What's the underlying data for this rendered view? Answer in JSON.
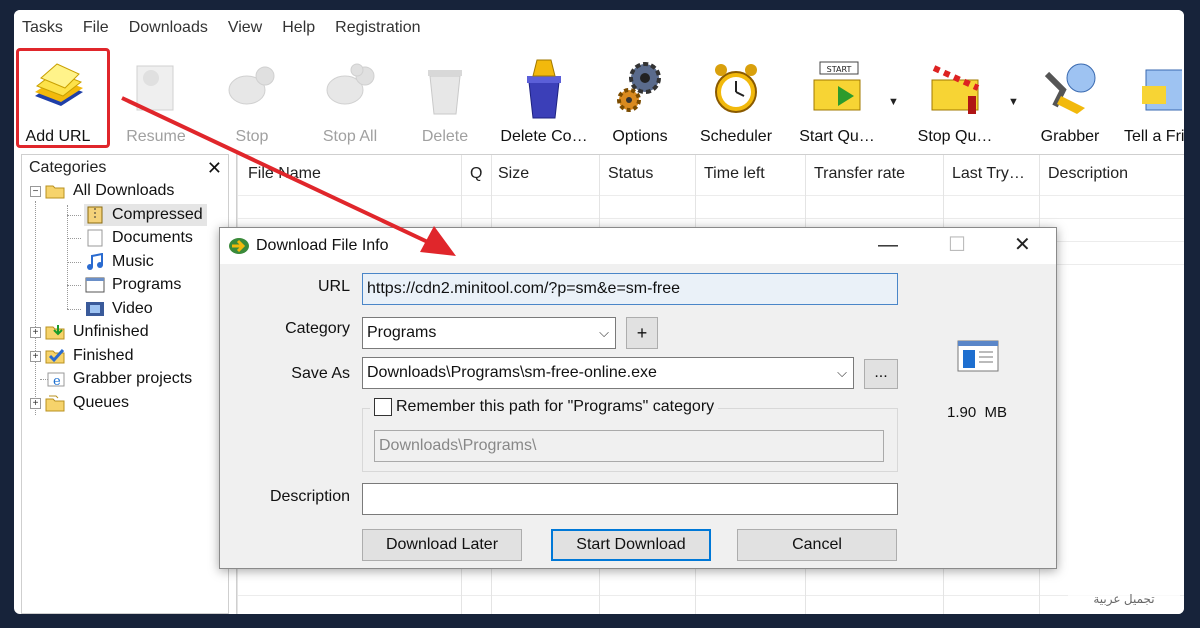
{
  "menu": [
    "Tasks",
    "File",
    "Downloads",
    "View",
    "Help",
    "Registration"
  ],
  "toolbar": {
    "add_url": "Add URL",
    "resume": "Resume",
    "stop": "Stop",
    "stop_all": "Stop All",
    "delete": "Delete",
    "delete_completed": "Delete Co…",
    "options": "Options",
    "scheduler": "Scheduler",
    "start_queue": "Start Qu…",
    "stop_queue": "Stop Qu…",
    "grabber": "Grabber",
    "tell_friend": "Tell a Fri"
  },
  "sidebar": {
    "title": "Categories",
    "close": "✕",
    "items": [
      "All Downloads",
      "Compressed",
      "Documents",
      "Music",
      "Programs",
      "Video",
      "Unfinished",
      "Finished",
      "Grabber projects",
      "Queues"
    ]
  },
  "list": {
    "columns": [
      "File Name",
      "Q",
      "Size",
      "Status",
      "Time left",
      "Transfer rate",
      "Last Try…",
      "Description"
    ]
  },
  "dialog": {
    "title": "Download File Info",
    "url_label": "URL",
    "url_value": "https://cdn2.minitool.com/?p=sm&e=sm-free",
    "category_label": "Category",
    "category_value": "Programs",
    "add_category": "+",
    "save_as_label": "Save As",
    "save_as_value": "Downloads\\Programs\\sm-free-online.exe",
    "browse": "...",
    "remember_label": "Remember this path for \"Programs\" category",
    "remember_path": "Downloads\\Programs\\",
    "description_label": "Description",
    "description_value": "",
    "file_size": "1.90  MB",
    "download_later": "Download Later",
    "start_download": "Start Download",
    "cancel": "Cancel",
    "minimize": "—",
    "maximize": "☐",
    "close": "✕"
  },
  "watermark": "تجميل عربية",
  "colors": {
    "highlight": "#e0262b",
    "accent": "#0078d7"
  }
}
